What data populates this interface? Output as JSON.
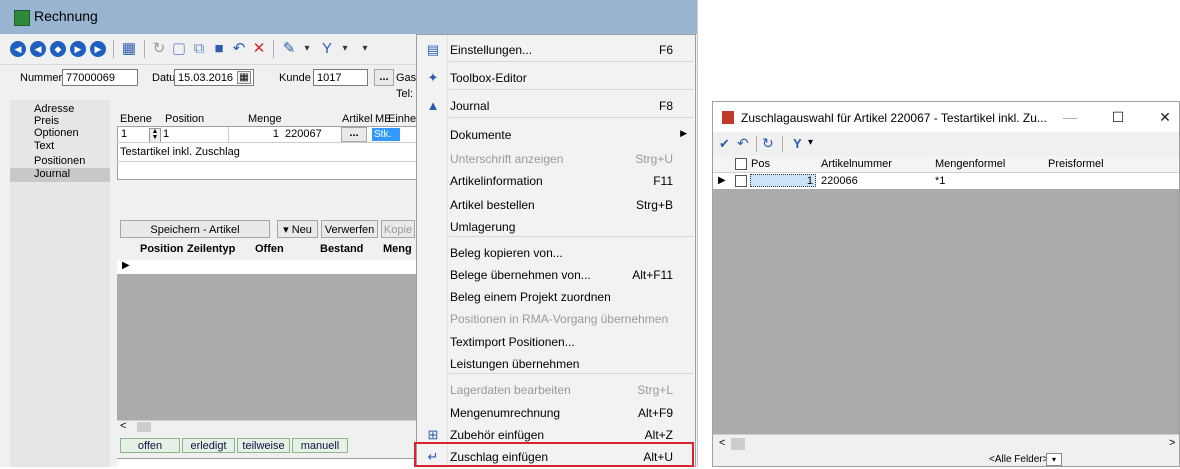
{
  "main_window": {
    "title": "Rechnung",
    "header": {
      "nummer_label": "Nummer",
      "nummer_value": "77000069",
      "datum_label": "Datum",
      "datum_value": "15.03.2016",
      "kunde_label": "Kunde",
      "kunde_value": "1017",
      "more_label": "...",
      "gas_label": "Gas",
      "tel_label": "Tel:"
    },
    "nav": [
      "Adresse",
      "Preis",
      "Optionen",
      "Text",
      "Positionen",
      "Journal"
    ],
    "position_labels": {
      "ebene": "Ebene",
      "position": "Position",
      "menge": "Menge",
      "artikel": "Artikel",
      "me": "ME",
      "einheit": "Einheit"
    },
    "position_values": {
      "ebene": "1",
      "position": "1",
      "menge": "1",
      "artikel": "220067",
      "more": "...",
      "einheit": "Stk."
    },
    "description": "Testartikel inkl. Zuschlag",
    "buttons": {
      "speichern": "Speichern - Artikel",
      "neu": "Neu",
      "verwerfen": "Verwerfen",
      "kopie": "Kopie"
    },
    "grid_headers": [
      "Position",
      "Zeilentyp",
      "Offen",
      "Bestand",
      "Meng"
    ],
    "status_tabs": [
      "offen",
      "erledigt",
      "teilweise",
      "manuell"
    ]
  },
  "context_menu": {
    "items": [
      {
        "label": "Einstellungen...",
        "shortcut": "F6",
        "icon": "settings-icon",
        "disabled": false
      },
      {
        "label": "Toolbox-Editor",
        "shortcut": "",
        "icon": "wand-icon",
        "disabled": false
      },
      {
        "label": "Journal",
        "shortcut": "F8",
        "icon": "bell-icon",
        "disabled": false
      },
      {
        "label": "Dokumente",
        "shortcut": "",
        "icon": "",
        "disabled": false,
        "submenu": true
      },
      {
        "label": "Unterschrift anzeigen",
        "shortcut": "Strg+U",
        "icon": "",
        "disabled": true
      },
      {
        "label": "Artikelinformation",
        "shortcut": "F11",
        "icon": "",
        "disabled": false
      },
      {
        "label": "Artikel bestellen",
        "shortcut": "Strg+B",
        "icon": "",
        "disabled": false
      },
      {
        "label": "Umlagerung",
        "shortcut": "",
        "icon": "",
        "disabled": false
      },
      {
        "label": "Beleg kopieren von...",
        "shortcut": "",
        "icon": "",
        "disabled": false
      },
      {
        "label": "Belege übernehmen von...",
        "shortcut": "Alt+F11",
        "icon": "",
        "disabled": false
      },
      {
        "label": "Beleg einem Projekt zuordnen",
        "shortcut": "",
        "icon": "",
        "disabled": false
      },
      {
        "label": "Positionen in RMA-Vorgang übernehmen",
        "shortcut": "",
        "icon": "",
        "disabled": true
      },
      {
        "label": "Textimport Positionen...",
        "shortcut": "",
        "icon": "",
        "disabled": false
      },
      {
        "label": "Leistungen übernehmen",
        "shortcut": "",
        "icon": "",
        "disabled": false
      },
      {
        "label": "Lagerdaten bearbeiten",
        "shortcut": "Strg+L",
        "icon": "",
        "disabled": true
      },
      {
        "label": "Mengenumrechnung",
        "shortcut": "Alt+F9",
        "icon": "",
        "disabled": false
      },
      {
        "label": "Zubehör einfügen",
        "shortcut": "Alt+Z",
        "icon": "add-icon",
        "disabled": false
      },
      {
        "label": "Zuschlag einfügen",
        "shortcut": "Alt+U",
        "icon": "return-icon",
        "disabled": false
      }
    ]
  },
  "dialog": {
    "title": "Zuschlagauswahl für Artikel 220067 - Testartikel inkl. Zu...",
    "columns": [
      "Pos",
      "Artikelnummer",
      "Mengenformel",
      "Preisformel"
    ],
    "row": {
      "pos": "1",
      "artikelnummer": "220066",
      "mengenformel": "*1",
      "preisformel": ""
    },
    "filter_label": "<Alle Felder>"
  },
  "colors": {
    "titlebar": "#99b4d1",
    "highlight_border": "#d9232e",
    "nav_icon": "#1f5fbf"
  }
}
